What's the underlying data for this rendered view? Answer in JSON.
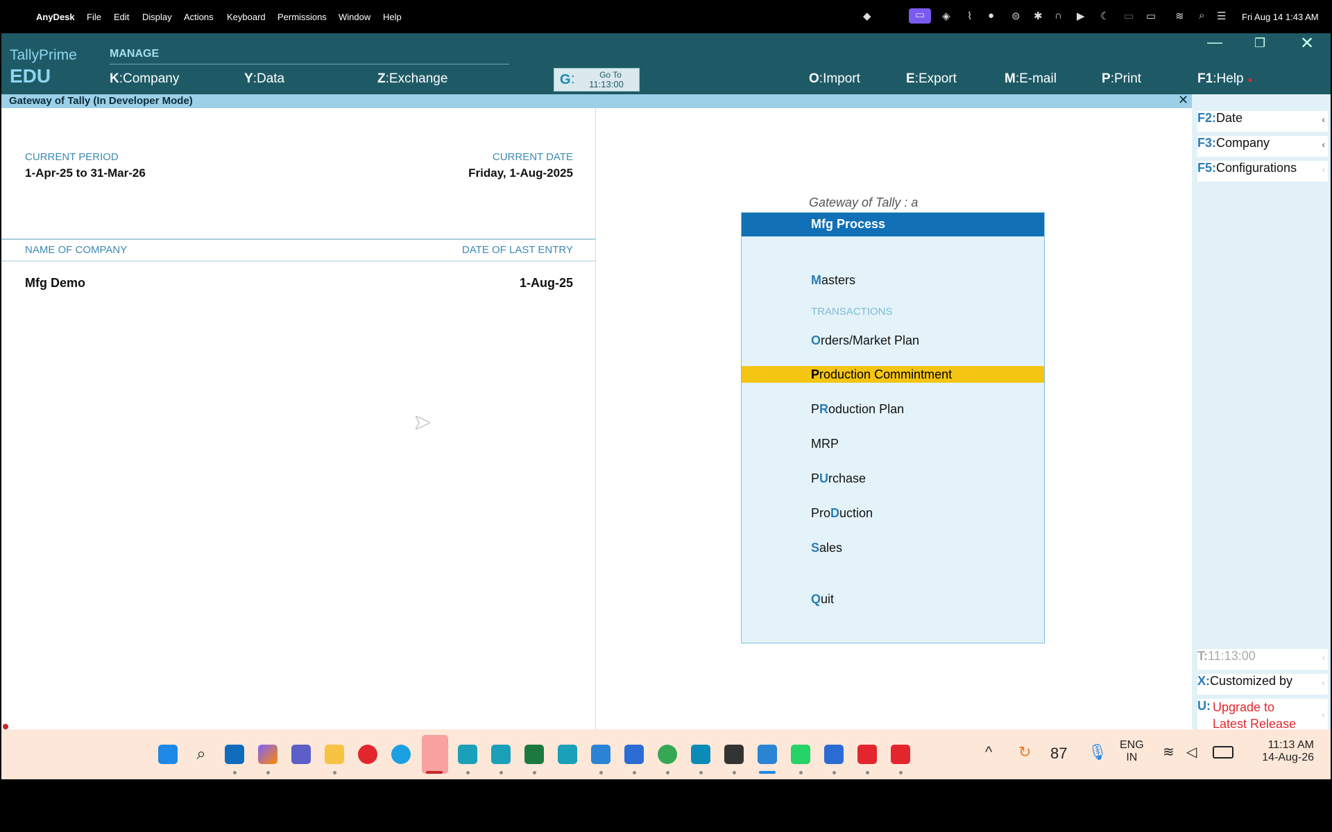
{
  "mac_menubar": {
    "app": "AnyDesk",
    "menus": [
      "File",
      "Edit",
      "Display",
      "Actions",
      "Keyboard",
      "Permissions",
      "Window",
      "Help"
    ],
    "datetime": "Fri Aug 14  1:43 AM"
  },
  "tally": {
    "brand": "TallyPrime",
    "edition": "EDU",
    "manage_label": "MANAGE",
    "header_actions": {
      "company": {
        "key": "K",
        "label": "Company"
      },
      "data": {
        "key": "Y",
        "label": "Data"
      },
      "exchange": {
        "key": "Z",
        "label": "Exchange"
      },
      "goto": {
        "key": "G",
        "label_top": "Go To",
        "label_bottom": "11:13:00"
      },
      "import": {
        "key": "O",
        "label": "Import"
      },
      "export": {
        "key": "E",
        "label": "Export"
      },
      "email": {
        "key": "M",
        "label": "E-mail"
      },
      "print": {
        "key": "P",
        "label": "Print"
      },
      "help": {
        "key": "F1",
        "label": "Help"
      }
    },
    "gateway_title": "Gateway of Tally (In Developer Mode)",
    "current_period_label": "CURRENT PERIOD",
    "current_period_value": "1-Apr-25 to 31-Mar-26",
    "current_date_label": "CURRENT DATE",
    "current_date_value": "Friday, 1-Aug-2025",
    "name_of_company_label": "NAME OF COMPANY",
    "date_of_last_entry_label": "DATE OF LAST ENTRY",
    "company_name": "Mfg Demo",
    "last_entry_date": "1-Aug-25",
    "menu": {
      "caption": "Gateway of Tally : a",
      "title": "Mfg Process",
      "masters": {
        "hot": "M",
        "rest": "asters"
      },
      "transactions_label": "TRANSACTIONS",
      "orders": {
        "hot": "O",
        "rest": "rders/Market Plan"
      },
      "production_commitment": {
        "hot": "P",
        "rest": "roduction Commintment"
      },
      "production_plan": {
        "pre": "P",
        "hot": "R",
        "rest": "oduction Plan"
      },
      "mrp": "MRP",
      "purchase": {
        "pre": "P",
        "hot": "U",
        "rest": "rchase"
      },
      "production": {
        "pre": "Pro",
        "hot": "D",
        "rest": "uction"
      },
      "sales": {
        "hot": "S",
        "rest": "ales"
      },
      "quit": {
        "hot": "Q",
        "rest": "uit"
      }
    },
    "right_panel": {
      "date": {
        "key": "F2:",
        "label": "Date"
      },
      "company": {
        "key": "F3:",
        "label": "Company"
      },
      "configurations": {
        "key": "F5:",
        "label": "Configurations"
      },
      "time": {
        "key": "T:",
        "label": "11:13:00"
      },
      "customized": {
        "key": "X:",
        "label": "Customized by"
      },
      "upgrade": {
        "key": "U:",
        "label_line1": "Upgrade to",
        "label_line2": "Latest Release"
      }
    }
  },
  "taskbar": {
    "badge": "87",
    "lang_top": "ENG",
    "lang_bottom": "IN",
    "time": "11:13 AM",
    "date": "14-Aug-26"
  },
  "colors": {
    "tally_header": "#1e5a66",
    "menu_title_bg": "#1170b6",
    "highlight": "#f4c513",
    "hotkey": "#2a7db5"
  }
}
